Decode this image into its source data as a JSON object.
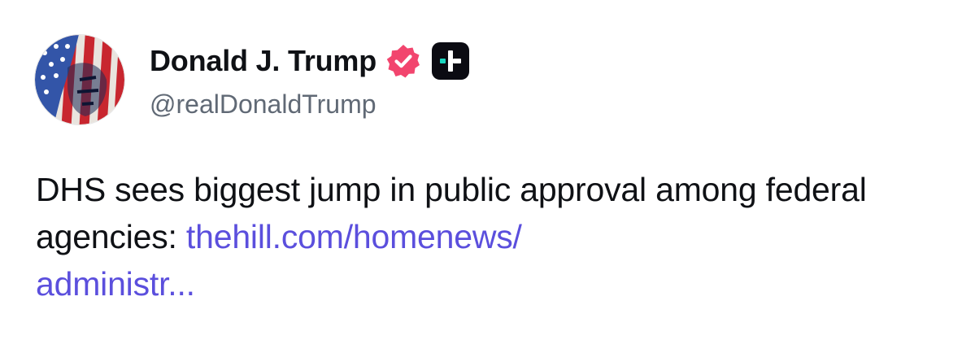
{
  "author": {
    "display_name": "Donald J. Trump",
    "handle": "@realDonaldTrump",
    "verified": true,
    "icons": [
      "verified-icon",
      "plus-badge-icon"
    ]
  },
  "post": {
    "text": "DHS sees biggest jump in public approval among federal agencies:",
    "link_line1": "thehill.com/homenews/",
    "link_line2": "administr..."
  },
  "colors": {
    "text": "#0f1115",
    "handle": "#606975",
    "link": "#5b4fdd",
    "verified": "#f2456e",
    "badge": "#0b0b12",
    "badge_accent": "#19d6c0"
  }
}
